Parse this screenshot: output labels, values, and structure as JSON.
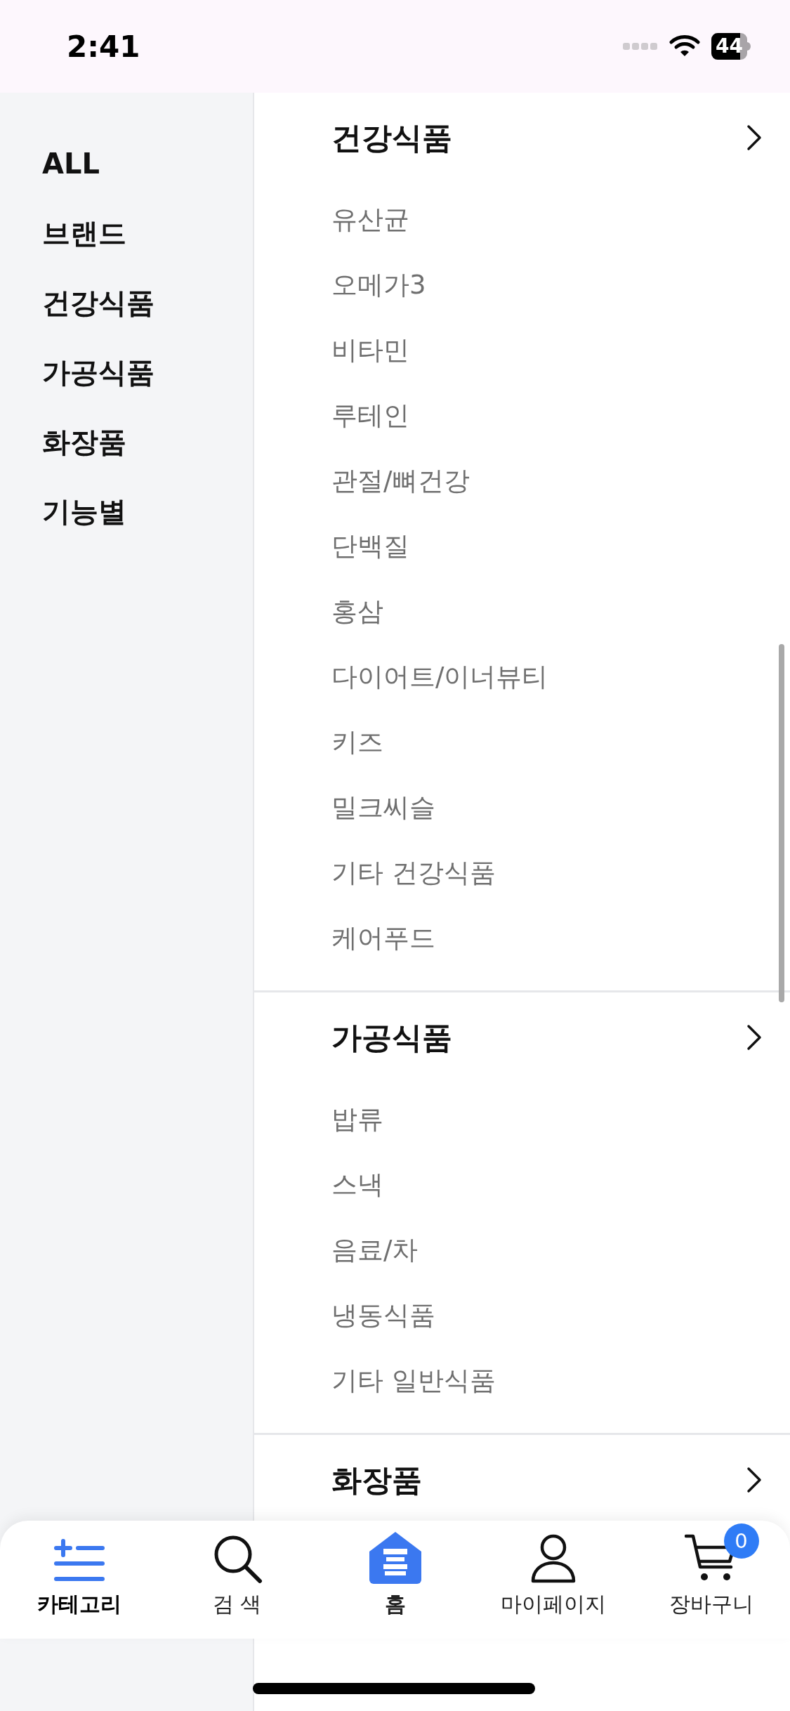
{
  "status_bar": {
    "time": "2:41",
    "battery": "44"
  },
  "sidebar": {
    "items": [
      "ALL",
      "브랜드",
      "건강식품",
      "가공식품",
      "화장품",
      "기능별"
    ]
  },
  "sections": [
    {
      "title": "건강식품",
      "items": [
        "유산균",
        "오메가3",
        "비타민",
        "루테인",
        "관절/뼈건강",
        "단백질",
        "홍삼",
        "다이어트/이너뷰티",
        "키즈",
        "밀크씨슬",
        "기타 건강식품",
        "케어푸드"
      ]
    },
    {
      "title": "가공식품",
      "items": [
        "밥류",
        "스낵",
        "음료/차",
        "냉동식품",
        "기타 일반식품"
      ]
    },
    {
      "title": "화장품"
    }
  ],
  "tab_bar": {
    "tabs": [
      {
        "label": "카테고리",
        "selected": true,
        "kind": "icon"
      },
      {
        "label": "검 색",
        "selected": false,
        "kind": "icon"
      },
      {
        "label": "홈",
        "selected": false,
        "kind": "logo"
      },
      {
        "label": "마이페이지",
        "selected": false,
        "kind": "icon"
      },
      {
        "label": "장바구니",
        "selected": false,
        "kind": "icon",
        "badge": "0"
      }
    ]
  }
}
